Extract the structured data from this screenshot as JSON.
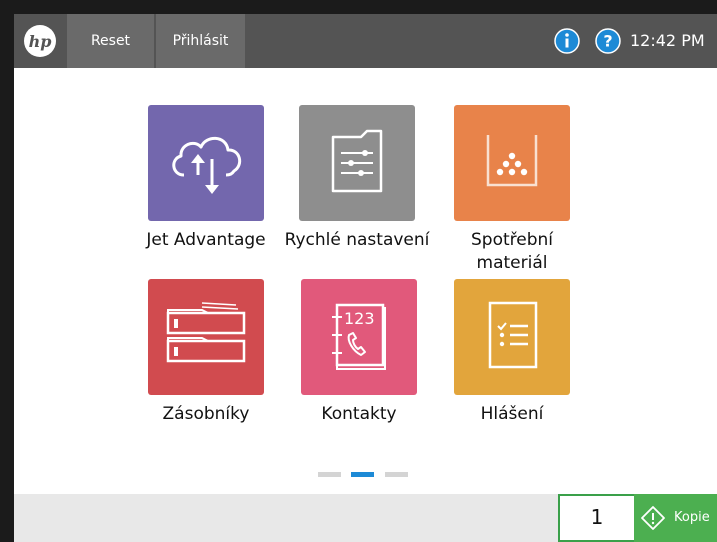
{
  "topbar": {
    "logo_text": "hp",
    "reset_label": "Reset",
    "login_label": "Přihlásit",
    "time": "12:42 PM"
  },
  "tiles": [
    {
      "label": "Jet Advantage",
      "icon": "cloud-sync-icon",
      "color": "#7367ad"
    },
    {
      "label": "Rychlé nastavení",
      "icon": "folder-settings-icon",
      "color": "#8e8e8e"
    },
    {
      "label": "Spotřební materiál",
      "icon": "supplies-icon",
      "color": "#e8834a"
    },
    {
      "label": "Zásobníky",
      "icon": "trays-icon",
      "color": "#d14b4f"
    },
    {
      "label": "Kontakty",
      "icon": "contacts-book-icon",
      "color": "#e1597b"
    },
    {
      "label": "Hlášení",
      "icon": "report-icon",
      "color": "#e2a53c"
    }
  ],
  "pager": {
    "pages": 3,
    "active": 2
  },
  "bottombar": {
    "copies": "1",
    "copy_label": "Kopie"
  },
  "colors": {
    "topbar": "#545454",
    "accent_blue": "#1d8ad6",
    "copy_green": "#4caf50"
  }
}
